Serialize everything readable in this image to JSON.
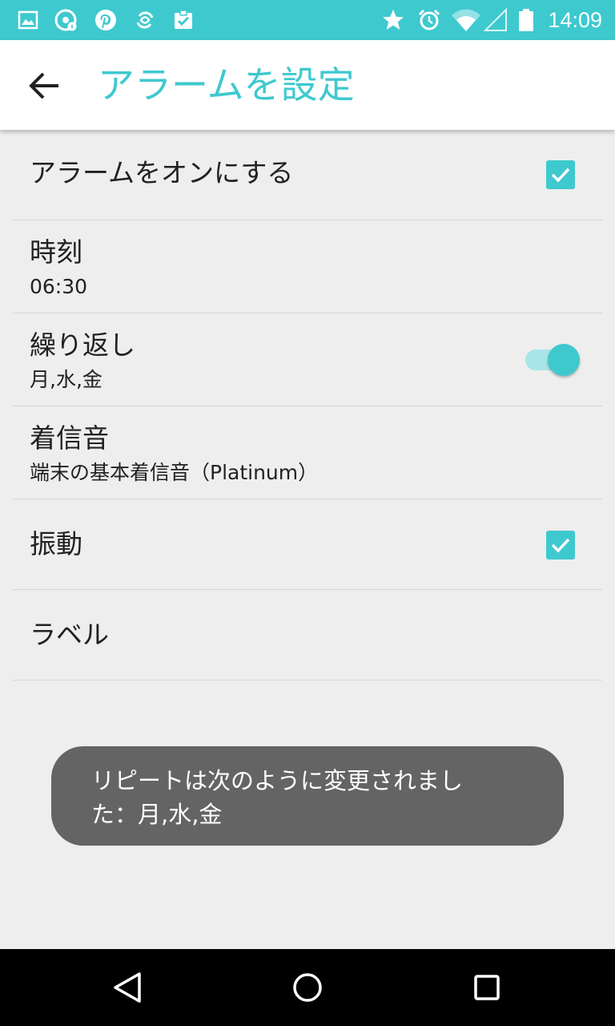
{
  "status_bar": {
    "time": "14:09",
    "left_icons": [
      "gallery-icon",
      "app-info-icon",
      "pinterest-icon",
      "sync-app-icon",
      "clipboard-check-icon"
    ],
    "right_icons": [
      "star-icon",
      "alarm-clock-icon",
      "wifi-icon",
      "cell-signal-icon",
      "battery-icon"
    ]
  },
  "app_bar": {
    "title": "アラームを設定",
    "back_icon": "arrow-left-icon"
  },
  "settings": {
    "alarm_on": {
      "title": "アラームをオンにする",
      "checked": true
    },
    "time": {
      "title": "時刻",
      "value": "06:30"
    },
    "repeat": {
      "title": "繰り返し",
      "value": "月,水,金",
      "enabled": true
    },
    "ringtone": {
      "title": "着信音",
      "value": "端末の基本着信音（Platinum）"
    },
    "vibrate": {
      "title": "振動",
      "checked": true
    },
    "label": {
      "title": "ラベル"
    }
  },
  "toast": {
    "line1": "リピートは次のように変更されまし",
    "line2": "た：月,水,金"
  },
  "nav_bar": {
    "icons": [
      "back-triangle-icon",
      "home-circle-icon",
      "recents-square-icon"
    ]
  },
  "colors": {
    "accent": "#3ec9cf",
    "background": "#eeeeee",
    "toast": "#646464"
  }
}
